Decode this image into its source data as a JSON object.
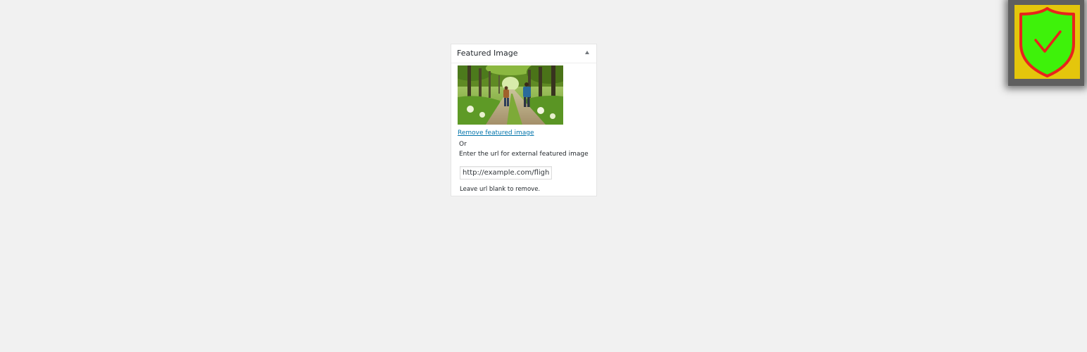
{
  "metabox": {
    "title": "Featured Image",
    "toggle_icon": "triangle-up-icon",
    "image_alt": "Two hikers walking on a green forest path",
    "remove_link": "Remove featured image",
    "or_text": "Or",
    "enter_text": "Enter the url for external featured image",
    "url_value": "http://example.com/flight-",
    "help_text": "Leave url blank to remove."
  },
  "badge": {
    "icon": "shield-check-icon",
    "colors": {
      "frame": "#5f5f5f",
      "background": "#e4c60c",
      "shield_fill": "#3ef20a",
      "shield_stroke": "#e8231c"
    }
  }
}
